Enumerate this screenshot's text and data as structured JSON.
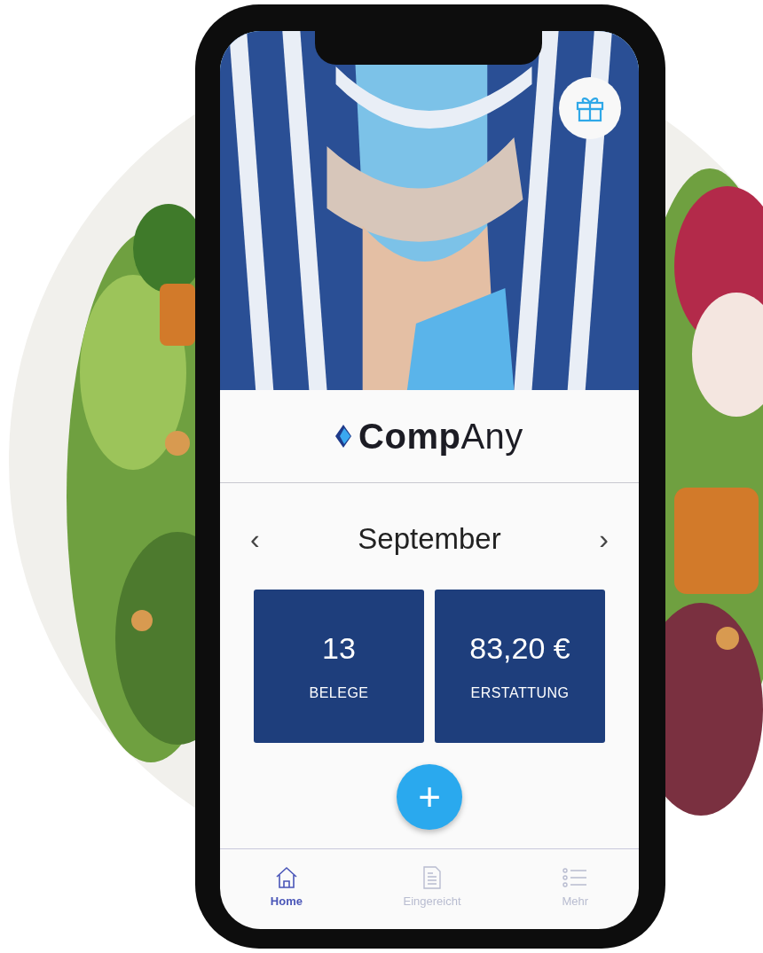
{
  "logo": {
    "text": "**Comp**Any"
  },
  "month": {
    "prev": "‹",
    "label": "September",
    "next": "›"
  },
  "stats": [
    {
      "value": "13",
      "label": "BELEGE"
    },
    {
      "value": "83,20 €",
      "label": "ERSTATTUNG"
    }
  ],
  "add_button": {
    "label": "+"
  },
  "nav": [
    {
      "label": "Home",
      "selected": true
    },
    {
      "label": "Eingereicht",
      "selected": false
    },
    {
      "label": "Mehr",
      "selected": false
    }
  ]
}
